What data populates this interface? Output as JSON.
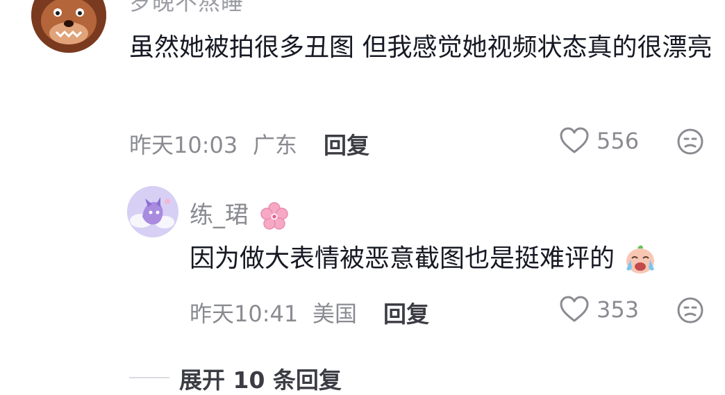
{
  "comment": {
    "username_partial": "岁晚不熬睡",
    "text": "虽然她被拍很多丑图 但我感觉她视频状态真的很漂亮",
    "time": "昨天10:03",
    "location": "广东",
    "reply_label": "回复",
    "likes": "556"
  },
  "reply": {
    "username": "练_珺",
    "text": "因为做大表情被恶意截图也是挺难评的",
    "time": "昨天10:41",
    "location": "美国",
    "reply_label": "回复",
    "likes": "353"
  },
  "expand": {
    "label": "展开 10 条回复"
  },
  "colors": {
    "text_primary": "#161823",
    "text_secondary": "#8a8b91",
    "reply_button": "#3c3d44"
  }
}
